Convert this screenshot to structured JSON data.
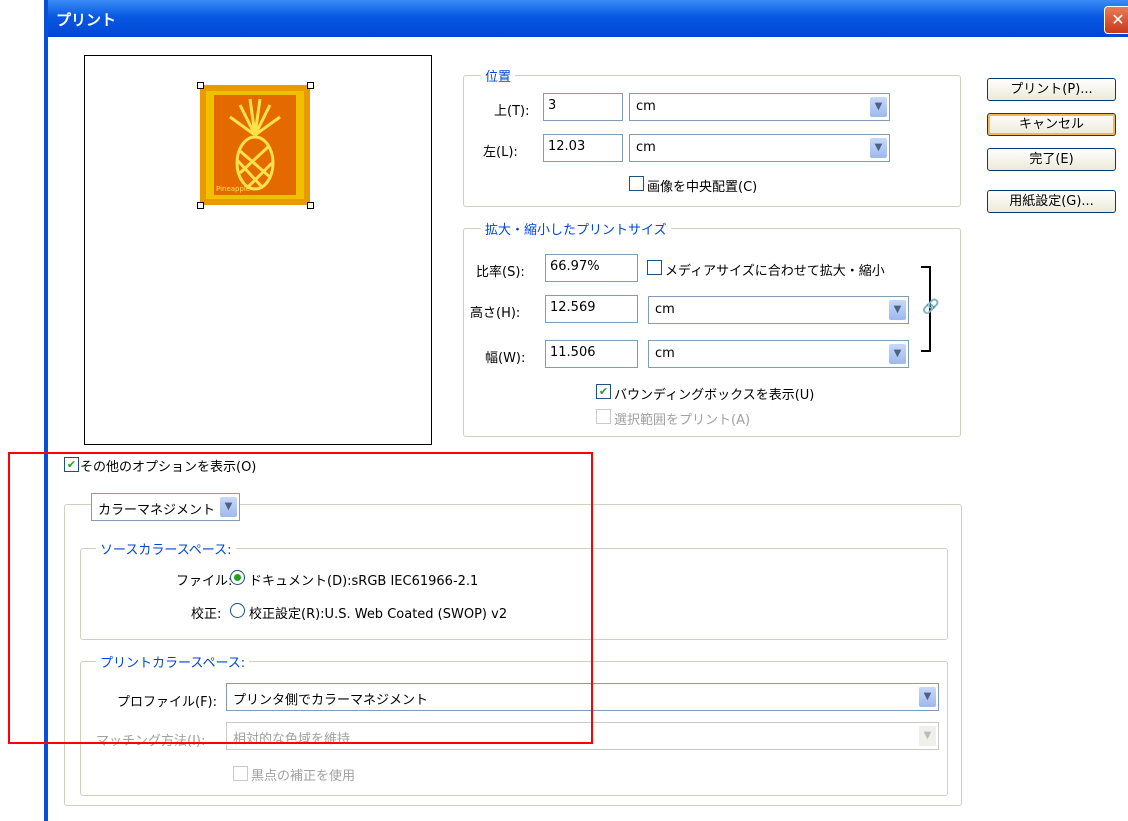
{
  "window": {
    "title": "プリント"
  },
  "buttons": {
    "print": "プリント(P)...",
    "cancel": "キャンセル",
    "done": "完了(E)",
    "page_setup": "用紙設定(G)..."
  },
  "position": {
    "group_title": "位置",
    "top_label": "上(T):",
    "top_value": "3",
    "top_unit": "cm",
    "left_label": "左(L):",
    "left_value": "12.03",
    "left_unit": "cm",
    "center_checkbox": "画像を中央配置(C)",
    "center_checked": false
  },
  "scaled_size": {
    "group_title": "拡大・縮小したプリントサイズ",
    "scale_label": "比率(S):",
    "scale_value": "66.97%",
    "fit_media_checkbox": "メディアサイズに合わせて拡大・縮小",
    "fit_media_checked": false,
    "height_label": "高さ(H):",
    "height_value": "12.569",
    "height_unit": "cm",
    "width_label": "幅(W):",
    "width_value": "11.506",
    "width_unit": "cm",
    "bbox_checkbox": "バウンディングボックスを表示(U)",
    "bbox_checked": true,
    "print_selection_checkbox": "選択範囲をプリント(A)",
    "print_selection_enabled": false
  },
  "more_options": {
    "checkbox_label": "その他のオプションを表示(O)",
    "checked": true,
    "section_select": "カラーマネジメント"
  },
  "source_space": {
    "group_title": "ソースカラースペース:",
    "file_label": "ファイル:",
    "document_option": "ドキュメント(D):sRGB IEC61966-2.1",
    "proof_label": "校正:",
    "proof_option": "校正設定(R):U.S. Web Coated (SWOP) v2",
    "selected": "document"
  },
  "print_space": {
    "group_title": "プリントカラースペース:",
    "profile_label": "プロファイル(F):",
    "profile_value": "プリンタ側でカラーマネジメント",
    "intent_label": "マッチング方法(I):",
    "intent_value": "相対的な色域を維持",
    "black_point_checkbox": "黒点の補正を使用"
  },
  "preview": {
    "image_caption": "Pineapple"
  },
  "colors": {
    "titlebar": "#0a4fd8",
    "group_title": "#0046d5",
    "highlight": "#ff0000"
  },
  "icons": [
    "close-icon",
    "dropdown-arrow-icon",
    "chain-link-icon",
    "pineapple-image"
  ]
}
